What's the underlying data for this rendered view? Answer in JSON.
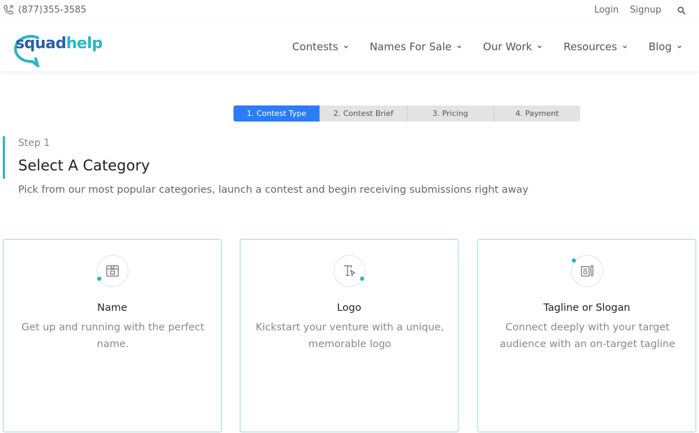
{
  "topbar": {
    "phone": "(877)355-3585",
    "login": "Login",
    "signup": "Signup"
  },
  "header": {
    "logo_part1": "squad",
    "logo_part2": "help",
    "nav": [
      {
        "label": "Contests"
      },
      {
        "label": "Names For Sale"
      },
      {
        "label": "Our Work"
      },
      {
        "label": "Resources"
      },
      {
        "label": "Blog"
      }
    ]
  },
  "stepper": {
    "steps": [
      {
        "label": "1. Contest Type"
      },
      {
        "label": "2. Contest Brief"
      },
      {
        "label": "3. Pricing"
      },
      {
        "label": "4. Payment"
      }
    ],
    "active_index": 0
  },
  "main": {
    "step_label": "Step 1",
    "title": "Select A Category",
    "subtitle": "Pick from our most popular categories, launch a contest and begin receiving submissions right away"
  },
  "cards": [
    {
      "title": "Name",
      "desc": "Get up and running with the perfect name.",
      "icon": "name-box-icon"
    },
    {
      "title": "Logo",
      "desc": "Kickstart your venture with a unique, memorable logo",
      "icon": "logo-typography-icon"
    },
    {
      "title": "Tagline or Slogan",
      "desc": "Connect deeply with your target audience with an on-target tagline",
      "icon": "tagline-pencil-icon"
    }
  ],
  "colors": {
    "accent": "#2bb6c4",
    "active_step": "#2d7cf6",
    "brand_blue": "#2a5fa8"
  }
}
